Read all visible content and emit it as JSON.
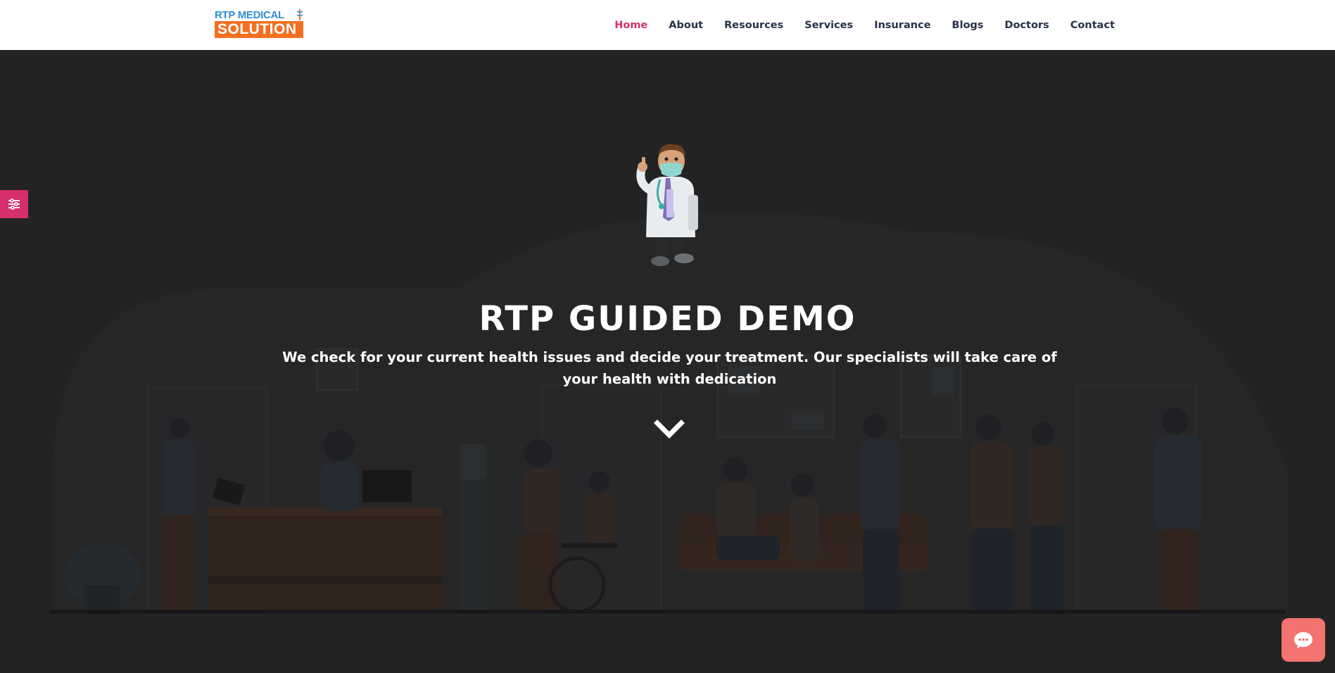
{
  "header": {
    "logo": {
      "line1": "RTP MEDICAL",
      "line2": "SOLUTION"
    },
    "nav": [
      {
        "label": "Home",
        "active": true
      },
      {
        "label": "About"
      },
      {
        "label": "Resources"
      },
      {
        "label": "Services"
      },
      {
        "label": "Insurance"
      },
      {
        "label": "Blogs"
      },
      {
        "label": "Doctors"
      },
      {
        "label": "Contact"
      }
    ]
  },
  "hero": {
    "title": "RTP GUIDED DEMO",
    "subtitle": "We check for your current health issues and decide your treatment. Our specialists will take care of your health with dedication",
    "scroll_icon": "chevron-down-icon",
    "mascot": "doctor-mascot"
  },
  "side_tab": {
    "icon": "sliders-icon"
  },
  "chat": {
    "icon": "chat-bubble-icon"
  },
  "colors": {
    "accent": "#d52f6d",
    "nav_text": "#27334a",
    "logo_blue": "#2f8fd0",
    "logo_orange": "#f36f21",
    "hero_bg": "#232323",
    "chat_button": "#f2736f"
  }
}
